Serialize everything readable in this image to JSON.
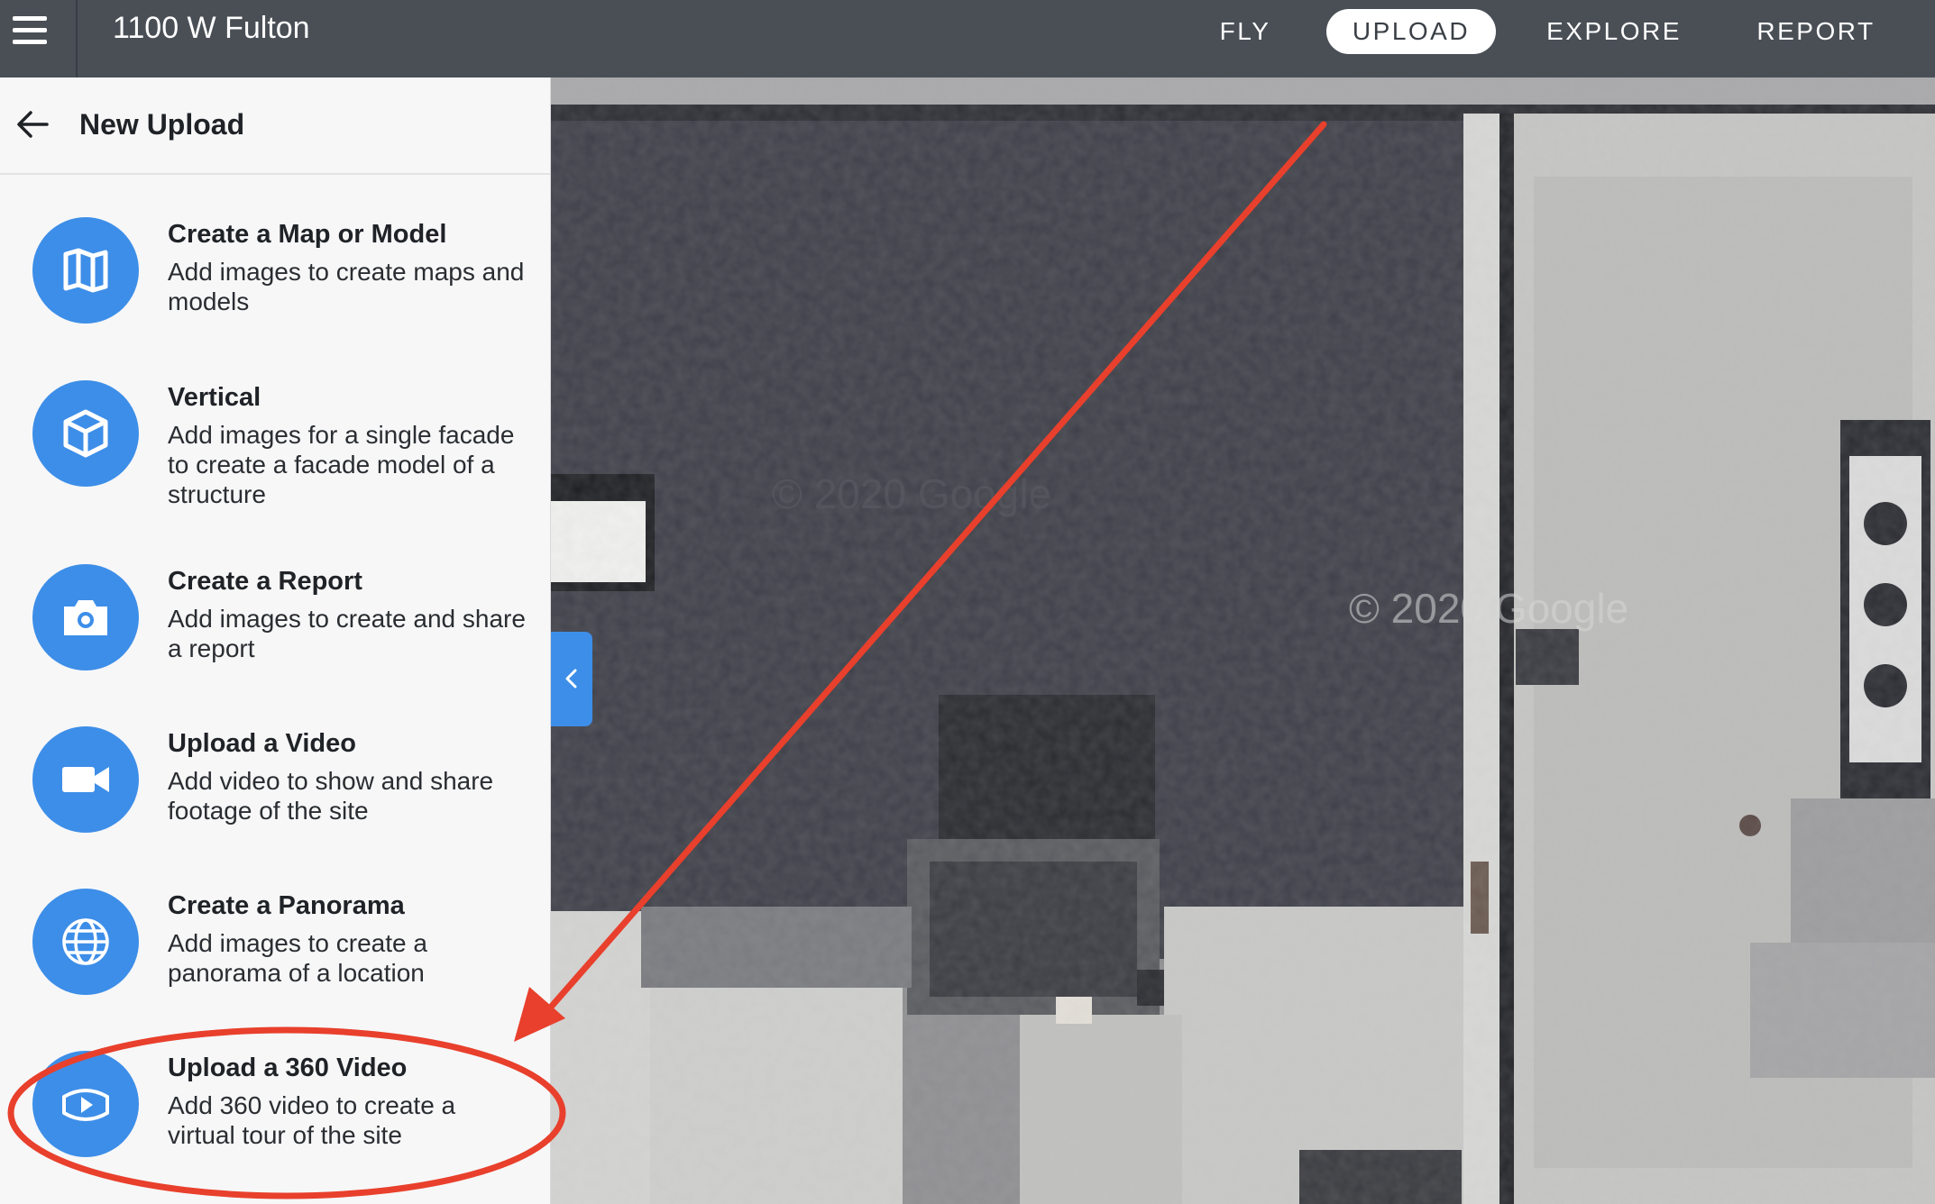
{
  "header": {
    "site_name": "1100 W Fulton",
    "nav": [
      {
        "label": "FLY",
        "active": false
      },
      {
        "label": "UPLOAD",
        "active": true
      },
      {
        "label": "EXPLORE",
        "active": false
      },
      {
        "label": "REPORT",
        "active": false
      }
    ]
  },
  "panel": {
    "title": "New Upload",
    "options": [
      {
        "title": "Create a Map or Model",
        "description": "Add images to create maps and models",
        "icon": "map-icon"
      },
      {
        "title": "Vertical",
        "description": "Add images for a single facade to create a facade model of a structure",
        "icon": "cube-icon"
      },
      {
        "title": "Create a Report",
        "description": "Add images to create and share a report",
        "icon": "camera-icon"
      },
      {
        "title": "Upload a Video",
        "description": "Add video to show and share footage of the site",
        "icon": "video-camera-icon"
      },
      {
        "title": "Create a Panorama",
        "description": "Add images to create a panorama of a location",
        "icon": "globe-icon"
      },
      {
        "title": "Upload a 360 Video",
        "description": "Add 360 video to create a virtual tour of the site",
        "icon": "360-video-icon"
      }
    ]
  },
  "map": {
    "watermarks": [
      "© 2020 Google",
      "© 2020 Google"
    ]
  },
  "colors": {
    "topbar": "#4a4f56",
    "accent": "#3d8ee8",
    "annotation": "#e8402c"
  }
}
